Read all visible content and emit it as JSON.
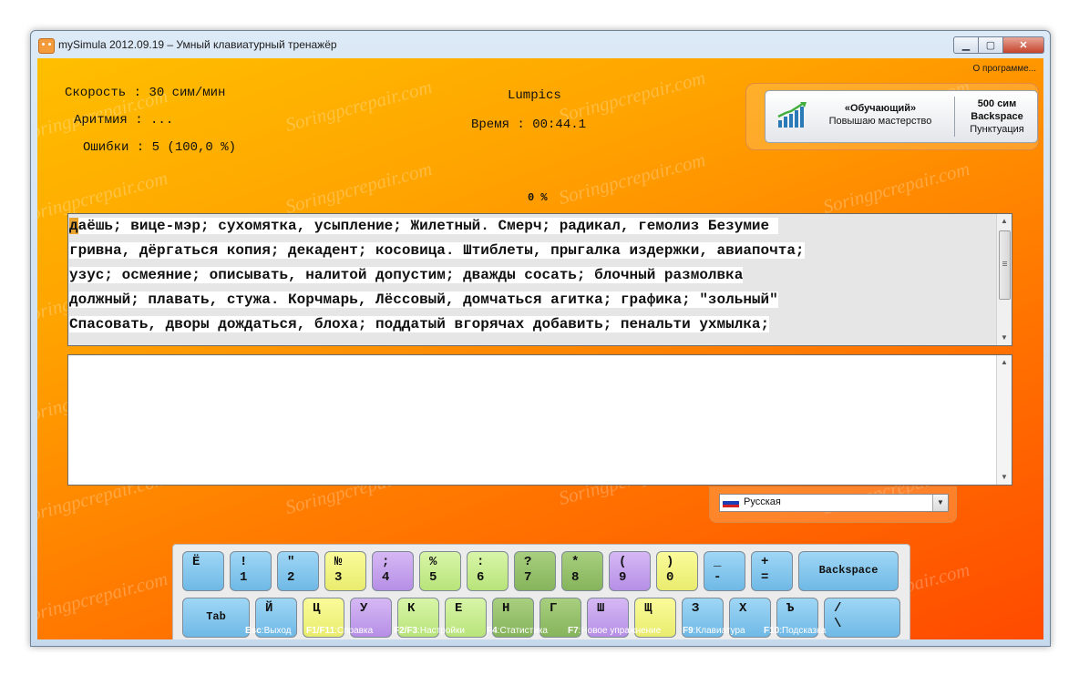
{
  "window": {
    "title": "mySimula 2012.09.19 – Умный клавиатурный тренажёр",
    "min_glyph": "▁",
    "max_glyph": "▢",
    "close_glyph": "✕"
  },
  "header": {
    "about_link": "О программе..."
  },
  "stats": {
    "speed": "Скорость : 30 сим/мин",
    "arrhythmia": "Аритмия : ...",
    "errors": "Ошибки : 5 (100,0 %)",
    "user": "Lumpics",
    "time": "Время : 00:44.1"
  },
  "mode_panel": {
    "mode_name": "«Обучающий»",
    "mode_desc": "Повышаю мастерство",
    "chars": "500 сим",
    "backspace": "Backspace",
    "punct": "Пунктуация"
  },
  "progress": {
    "label": "0 %",
    "value_percent": 0
  },
  "exercise": {
    "lines": [
      "даёшь; вице-мэр; сухомятка, усыпление; Жилетный. Смерч; радикал, гемолиз Безумие",
      "гривна, дёргаться копия; декадент; косовица. Штиблеты, прыгалка издержки, авиапочта;",
      "узус; осмеяние; описывать, налитой допустим; дважды сосать; блочный размолвка",
      "должный; плавать, стужа. Корчмарь, Лёссовый, домчаться агитка; графика; \"зольный\"",
      "Спасовать, дворы дождаться, блоха; поддатый вгорячах добавить; пенальти ухмылка;"
    ],
    "cursor_char": "д",
    "first_line_rest": "аёшь; вице-мэр; сухомятка, усыпление; Жилетный. Смерч; радикал, гемолиз Безумие",
    "scroll_up": "▲",
    "scroll_down": "▼"
  },
  "input": {
    "value": "",
    "scroll_up": "▲",
    "scroll_down": "▼"
  },
  "language": {
    "selected": "Русская",
    "dropdown_glyph": "▼"
  },
  "keyboard": {
    "row1": [
      {
        "top": "Ё",
        "bottom": "",
        "color": "blue"
      },
      {
        "top": "!",
        "bottom": "1",
        "color": "blue"
      },
      {
        "top": "\"",
        "bottom": "2",
        "color": "blue"
      },
      {
        "top": "№",
        "bottom": "3",
        "color": "yellow"
      },
      {
        "top": ";",
        "bottom": "4",
        "color": "purple"
      },
      {
        "top": "%",
        "bottom": "5",
        "color": "lgreen"
      },
      {
        "top": ":",
        "bottom": "6",
        "color": "lgreen"
      },
      {
        "top": "?",
        "bottom": "7",
        "color": "dgreen"
      },
      {
        "top": "*",
        "bottom": "8",
        "color": "dgreen"
      },
      {
        "top": "(",
        "bottom": "9",
        "color": "purple"
      },
      {
        "top": ")",
        "bottom": "0",
        "color": "yellow"
      },
      {
        "top": "_",
        "bottom": "-",
        "color": "blue"
      },
      {
        "top": "+",
        "bottom": "=",
        "color": "blue"
      },
      {
        "top": "Backspace",
        "bottom": "",
        "color": "blue"
      }
    ],
    "row2": [
      {
        "top": "Tab",
        "bottom": "",
        "color": "blue"
      },
      {
        "top": "Й",
        "bottom": "",
        "color": "blue"
      },
      {
        "top": "Ц",
        "bottom": "",
        "color": "yellow"
      },
      {
        "top": "У",
        "bottom": "",
        "color": "purple"
      },
      {
        "top": "К",
        "bottom": "",
        "color": "lgreen"
      },
      {
        "top": "Е",
        "bottom": "",
        "color": "lgreen"
      },
      {
        "top": "Н",
        "bottom": "",
        "color": "dgreen"
      },
      {
        "top": "Г",
        "bottom": "",
        "color": "dgreen"
      },
      {
        "top": "Ш",
        "bottom": "",
        "color": "purple"
      },
      {
        "top": "Щ",
        "bottom": "",
        "color": "yellow"
      },
      {
        "top": "З",
        "bottom": "",
        "color": "blue"
      },
      {
        "top": "Х",
        "bottom": "",
        "color": "blue"
      },
      {
        "top": "Ъ",
        "bottom": "",
        "color": "blue"
      },
      {
        "top": "/",
        "bottom": "\\",
        "color": "blue"
      }
    ]
  },
  "hotkeys": [
    {
      "key": "Esc",
      "label": ":Выход"
    },
    {
      "key": "F1/F11",
      "label": ":Справка"
    },
    {
      "key": "F2/F3",
      "label": ":Настройки"
    },
    {
      "key": "F4",
      "label": ":Статистика"
    },
    {
      "key": "F7",
      "label": ":Новое упражнение"
    },
    {
      "key": "F9",
      "label": ":Клавиатура"
    },
    {
      "key": "F10",
      "label": ":Подсказка"
    }
  ],
  "watermark": "Soringpcrepair.com",
  "colors": {
    "bg_top": "#ffbf00",
    "bg_bottom": "#ff4a00",
    "key_blue": "#8ccaf0",
    "key_yellow": "#f3f58a",
    "key_purple": "#c7a4ee",
    "key_lgreen": "#cbee94",
    "key_dgreen": "#98c26e",
    "cursor": "#e8a42e"
  }
}
